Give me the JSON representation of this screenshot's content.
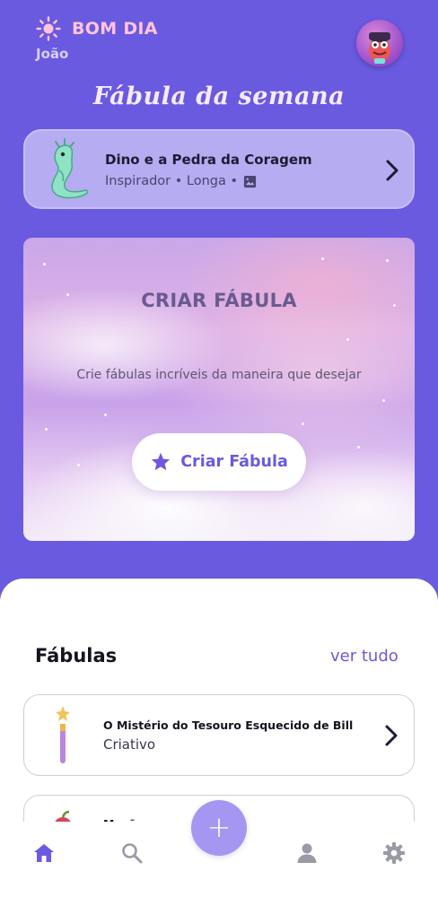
{
  "header": {
    "greeting": "BOM DIA",
    "user_name": "João",
    "icons": {
      "greeting": "sun-icon",
      "avatar": "avatar"
    }
  },
  "week": {
    "section_title": "Fábula da semana",
    "card": {
      "title": "Dino e a Pedra da Coragem",
      "meta": "Inspirador • Longa •",
      "icons": [
        "dino-illustration",
        "image-icon",
        "chevron-right-icon"
      ]
    }
  },
  "create": {
    "title": "CRIAR FÁBULA",
    "subtitle": "Crie fábulas incríveis da maneira que desejar",
    "button_label": "Criar Fábula",
    "button_icon": "star-icon"
  },
  "fabulas": {
    "section_title": "Fábulas",
    "see_all": "ver tudo",
    "items": [
      {
        "title": "O Mistério do Tesouro Esquecido de Bill",
        "category": "Criativo",
        "icon": "magic-wand-icon"
      },
      {
        "title": "Maçã",
        "category": "",
        "icon": "apple-icon"
      }
    ]
  },
  "bottom_nav": {
    "add_label": "+",
    "items": [
      "home-icon",
      "search-icon",
      "add-icon",
      "profile-icon",
      "settings-icon"
    ]
  },
  "colors": {
    "background": "#6a5ae0",
    "accent": "#6a5ae0",
    "greeting": "#ffc4dc",
    "week_card": "#b5acf1",
    "add_button": "#a596f2"
  }
}
